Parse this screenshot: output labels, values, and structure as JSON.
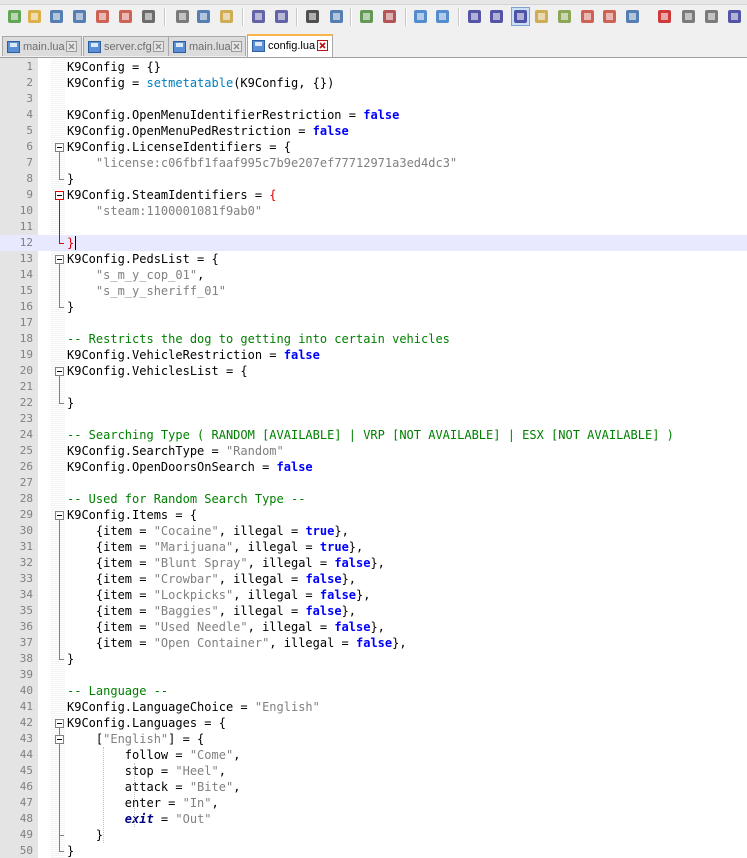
{
  "toolbar": {
    "icons": [
      "new-file-icon",
      "open-file-icon",
      "save-icon",
      "save-all-icon",
      "close-icon",
      "close-all-icon",
      "print-icon",
      "cut-icon",
      "copy-icon",
      "paste-icon",
      "undo-icon",
      "redo-icon",
      "find-icon",
      "replace-icon",
      "zoom-in-icon",
      "zoom-out-icon",
      "sync-vertical-icon",
      "sync-horizontal-icon",
      "word-wrap-icon",
      "show-all-chars-icon",
      "indent-guide-icon",
      "user-language-icon",
      "doc-map-icon",
      "function-list-icon",
      "folder-workspace-icon",
      "monitoring-icon",
      "record-macro-icon",
      "stop-macro-icon",
      "play-macro-icon",
      "run-macro-multiple-icon"
    ]
  },
  "tabs": [
    {
      "label": "main.lua",
      "active": false
    },
    {
      "label": "server.cfg",
      "active": false
    },
    {
      "label": "main.lua",
      "active": false
    },
    {
      "label": "config.lua",
      "active": true
    }
  ],
  "editor": {
    "current_line": 12,
    "lines": [
      {
        "n": "1",
        "t": [
          [
            "K9Config = {}",
            ""
          ]
        ]
      },
      {
        "n": "2",
        "t": [
          [
            "K9Config = ",
            ""
          ],
          [
            "setmetatable",
            "fn"
          ],
          [
            "(K9Config, {})",
            ""
          ]
        ]
      },
      {
        "n": "3",
        "t": []
      },
      {
        "n": "4",
        "t": [
          [
            "K9Config.OpenMenuIdentifierRestriction = ",
            ""
          ],
          [
            "false",
            "kw"
          ]
        ]
      },
      {
        "n": "5",
        "t": [
          [
            "K9Config.OpenMenuPedRestriction = ",
            ""
          ],
          [
            "false",
            "kw"
          ]
        ]
      },
      {
        "n": "6",
        "t": [
          [
            "K9Config.LicenseIdentifiers = {",
            ""
          ]
        ]
      },
      {
        "n": "7",
        "t": [
          [
            "    ",
            ""
          ],
          [
            "\"license:c06fbf1faaf995c7b9e207ef77712971a3ed4dc3\"",
            "str"
          ]
        ]
      },
      {
        "n": "8",
        "t": [
          [
            "}",
            ""
          ]
        ]
      },
      {
        "n": "9",
        "t": [
          [
            "K9Config.SteamIdentifiers = ",
            ""
          ],
          [
            "{",
            "red"
          ]
        ]
      },
      {
        "n": "10",
        "t": [
          [
            "    ",
            ""
          ],
          [
            "\"steam:1100001081f9ab0\"",
            "str"
          ]
        ]
      },
      {
        "n": "11",
        "t": []
      },
      {
        "n": "12",
        "t": [
          [
            "}",
            "red"
          ]
        ]
      },
      {
        "n": "13",
        "t": [
          [
            "K9Config.PedsList = {",
            ""
          ]
        ]
      },
      {
        "n": "14",
        "t": [
          [
            "    ",
            ""
          ],
          [
            "\"s_m_y_cop_01\"",
            "str"
          ],
          [
            ",",
            ""
          ]
        ]
      },
      {
        "n": "15",
        "t": [
          [
            "    ",
            ""
          ],
          [
            "\"s_m_y_sheriff_01\"",
            "str"
          ]
        ]
      },
      {
        "n": "16",
        "t": [
          [
            "}",
            ""
          ]
        ]
      },
      {
        "n": "17",
        "t": []
      },
      {
        "n": "18",
        "t": [
          [
            "-- Restricts the dog to getting into certain vehicles",
            "cm"
          ]
        ]
      },
      {
        "n": "19",
        "t": [
          [
            "K9Config.VehicleRestriction = ",
            ""
          ],
          [
            "false",
            "kw"
          ]
        ]
      },
      {
        "n": "20",
        "t": [
          [
            "K9Config.VehiclesList = {",
            ""
          ]
        ]
      },
      {
        "n": "21",
        "t": []
      },
      {
        "n": "22",
        "t": [
          [
            "}",
            ""
          ]
        ]
      },
      {
        "n": "23",
        "t": []
      },
      {
        "n": "24",
        "t": [
          [
            "-- Searching Type ( RANDOM [AVAILABLE] | VRP [NOT AVAILABLE] | ESX [NOT AVAILABLE] )",
            "cm"
          ]
        ]
      },
      {
        "n": "25",
        "t": [
          [
            "K9Config.SearchType = ",
            ""
          ],
          [
            "\"Random\"",
            "str"
          ]
        ]
      },
      {
        "n": "26",
        "t": [
          [
            "K9Config.OpenDoorsOnSearch = ",
            ""
          ],
          [
            "false",
            "kw"
          ]
        ]
      },
      {
        "n": "27",
        "t": []
      },
      {
        "n": "28",
        "t": [
          [
            "-- Used for Random Search Type --",
            "cm"
          ]
        ]
      },
      {
        "n": "29",
        "t": [
          [
            "K9Config.Items = {",
            ""
          ]
        ]
      },
      {
        "n": "30",
        "t": [
          [
            "    {item = ",
            ""
          ],
          [
            "\"Cocaine\"",
            "str"
          ],
          [
            ", illegal = ",
            ""
          ],
          [
            "true",
            "kw"
          ],
          [
            "},",
            ""
          ]
        ]
      },
      {
        "n": "31",
        "t": [
          [
            "    {item = ",
            ""
          ],
          [
            "\"Marijuana\"",
            "str"
          ],
          [
            ", illegal = ",
            ""
          ],
          [
            "true",
            "kw"
          ],
          [
            "},",
            ""
          ]
        ]
      },
      {
        "n": "32",
        "t": [
          [
            "    {item = ",
            ""
          ],
          [
            "\"Blunt Spray\"",
            "str"
          ],
          [
            ", illegal = ",
            ""
          ],
          [
            "false",
            "kw"
          ],
          [
            "},",
            ""
          ]
        ]
      },
      {
        "n": "33",
        "t": [
          [
            "    {item = ",
            ""
          ],
          [
            "\"Crowbar\"",
            "str"
          ],
          [
            ", illegal = ",
            ""
          ],
          [
            "false",
            "kw"
          ],
          [
            "},",
            ""
          ]
        ]
      },
      {
        "n": "34",
        "t": [
          [
            "    {item = ",
            ""
          ],
          [
            "\"Lockpicks\"",
            "str"
          ],
          [
            ", illegal = ",
            ""
          ],
          [
            "false",
            "kw"
          ],
          [
            "},",
            ""
          ]
        ]
      },
      {
        "n": "35",
        "t": [
          [
            "    {item = ",
            ""
          ],
          [
            "\"Baggies\"",
            "str"
          ],
          [
            ", illegal = ",
            ""
          ],
          [
            "false",
            "kw"
          ],
          [
            "},",
            ""
          ]
        ]
      },
      {
        "n": "36",
        "t": [
          [
            "    {item = ",
            ""
          ],
          [
            "\"Used Needle\"",
            "str"
          ],
          [
            ", illegal = ",
            ""
          ],
          [
            "false",
            "kw"
          ],
          [
            "},",
            ""
          ]
        ]
      },
      {
        "n": "37",
        "t": [
          [
            "    {item = ",
            ""
          ],
          [
            "\"Open Container\"",
            "str"
          ],
          [
            ", illegal = ",
            ""
          ],
          [
            "false",
            "kw"
          ],
          [
            "},",
            ""
          ]
        ]
      },
      {
        "n": "38",
        "t": [
          [
            "}",
            ""
          ]
        ]
      },
      {
        "n": "39",
        "t": []
      },
      {
        "n": "40",
        "t": [
          [
            "-- Language --",
            "cm"
          ]
        ]
      },
      {
        "n": "41",
        "t": [
          [
            "K9Config.LanguageChoice = ",
            ""
          ],
          [
            "\"English\"",
            "str"
          ]
        ]
      },
      {
        "n": "42",
        "t": [
          [
            "K9Config.Languages = {",
            ""
          ]
        ]
      },
      {
        "n": "43",
        "t": [
          [
            "    [",
            ""
          ],
          [
            "\"English\"",
            "str"
          ],
          [
            "] = {",
            ""
          ]
        ]
      },
      {
        "n": "44",
        "t": [
          [
            "        follow = ",
            ""
          ],
          [
            "\"Come\"",
            "str"
          ],
          [
            ",",
            ""
          ]
        ]
      },
      {
        "n": "45",
        "t": [
          [
            "        stop = ",
            ""
          ],
          [
            "\"Heel\"",
            "str"
          ],
          [
            ",",
            ""
          ]
        ]
      },
      {
        "n": "46",
        "t": [
          [
            "        attack = ",
            ""
          ],
          [
            "\"Bite\"",
            "str"
          ],
          [
            ",",
            ""
          ]
        ]
      },
      {
        "n": "47",
        "t": [
          [
            "        enter = ",
            ""
          ],
          [
            "\"In\"",
            "str"
          ],
          [
            ",",
            ""
          ]
        ]
      },
      {
        "n": "48",
        "t": [
          [
            "        ",
            ""
          ],
          [
            "exit",
            "kwi"
          ],
          [
            " = ",
            ""
          ],
          [
            "\"Out\"",
            "str"
          ]
        ]
      },
      {
        "n": "49",
        "t": [
          [
            "    }",
            ""
          ]
        ]
      },
      {
        "n": "50",
        "t": [
          [
            "}",
            ""
          ]
        ]
      }
    ]
  }
}
